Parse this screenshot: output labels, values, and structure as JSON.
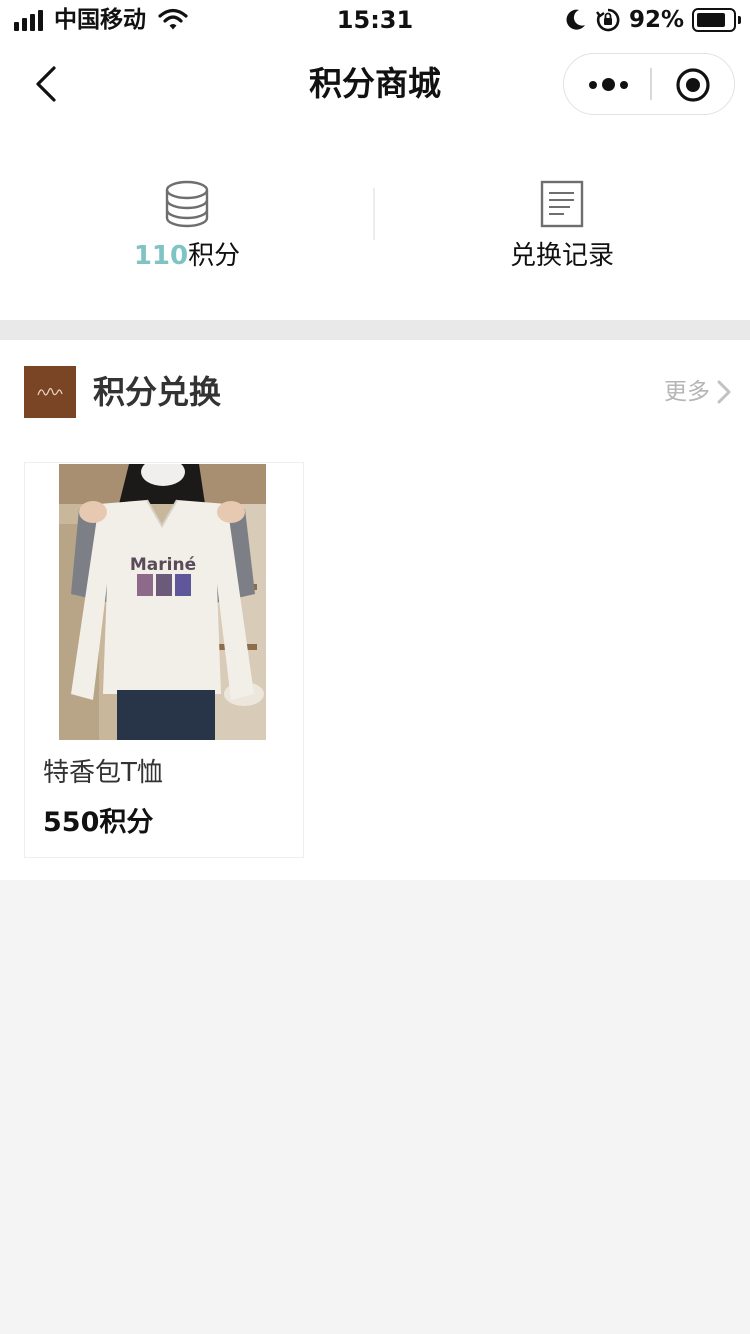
{
  "status_bar": {
    "carrier": "中国移动",
    "time": "15:31",
    "battery_percent": "92%",
    "battery_level": 0.92,
    "icons": [
      "signal-icon",
      "wifi-icon",
      "moon-icon",
      "rotation-lock-icon",
      "battery-icon"
    ]
  },
  "nav": {
    "title": "积分商城",
    "back_icon": "chevron-left-icon",
    "more_icon": "more-dots-icon",
    "close_icon": "target-circle-icon"
  },
  "points": {
    "value": "110",
    "unit": "积分",
    "icon": "coin-stack-icon",
    "records_label": "兑换记录",
    "records_icon": "document-icon"
  },
  "exchange": {
    "title": "积分兑换",
    "more_label": "更多",
    "more_icon": "chevron-right-icon",
    "products": [
      {
        "name": "特香包T恤",
        "price": "550积分",
        "image_text": "Mariné"
      }
    ]
  },
  "colors": {
    "accent_points": "#7fc3c3",
    "thumb_brown": "#7a4525",
    "page_background": "#f4f4f4"
  }
}
